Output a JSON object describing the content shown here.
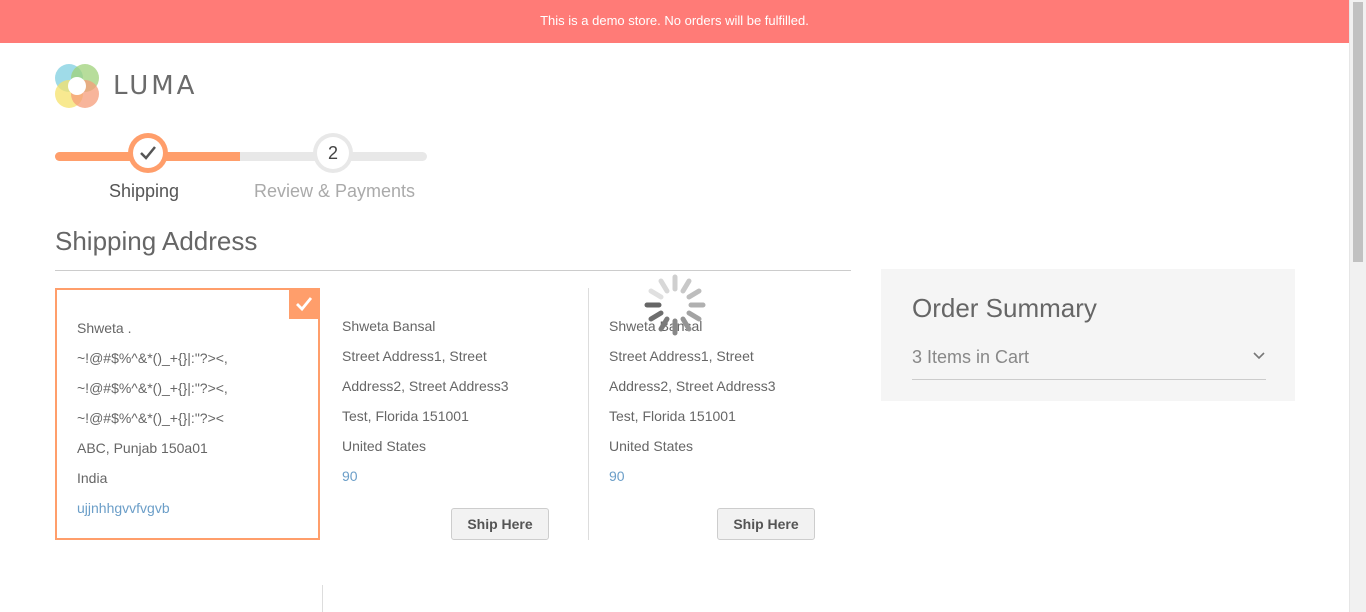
{
  "banner": {
    "text": "This is a demo store. No orders will be fulfilled."
  },
  "logo": {
    "text": "LUMA"
  },
  "progress": {
    "steps": [
      {
        "number": "",
        "label": "Shipping",
        "state": "complete"
      },
      {
        "number": "2",
        "label": "Review & Payments",
        "state": "pending"
      }
    ],
    "completion_fraction": 0.5
  },
  "shipping": {
    "title": "Shipping Address",
    "addresses": [
      {
        "selected": true,
        "lines": [
          "Shweta .",
          "~!@#$%^&*()_+{}|:\"?><,",
          "~!@#$%^&*()_+{}|:\"?><,",
          "~!@#$%^&*()_+{}|:\"?><",
          "ABC, Punjab 150a01",
          "India"
        ],
        "phone": "ujjnhhgvvfvgvb"
      },
      {
        "selected": false,
        "lines": [
          "Shweta Bansal",
          "Street Address1, Street",
          "Address2, Street Address3",
          "Test, Florida 151001",
          "United States"
        ],
        "phone": "90",
        "button": "Ship Here"
      },
      {
        "selected": false,
        "lines": [
          "Shweta Bansal",
          "Street Address1, Street",
          "Address2, Street Address3",
          "Test, Florida 151001",
          "United States"
        ],
        "phone": "90",
        "button": "Ship Here"
      }
    ]
  },
  "summary": {
    "title": "Order Summary",
    "items_label": "3 Items in Cart"
  },
  "colors": {
    "banner": "#ff7b77",
    "accent": "#ff9e6b",
    "link": "#6b9ec8"
  },
  "icons": [
    "checkmark-icon",
    "spinner-icon",
    "chevron-down-icon"
  ]
}
